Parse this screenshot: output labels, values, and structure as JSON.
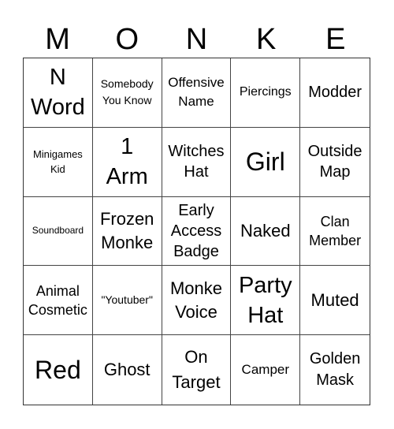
{
  "title_letters": [
    "M",
    "O",
    "N",
    "K",
    "E"
  ],
  "cells": [
    {
      "text": "N Word"
    },
    {
      "text": "Somebody You Know"
    },
    {
      "text": "Offensive Name"
    },
    {
      "text": "Piercings"
    },
    {
      "text": "Modder"
    },
    {
      "text": "Minigames Kid"
    },
    {
      "text": "1 Arm"
    },
    {
      "text": "Witches Hat"
    },
    {
      "text": "Girl"
    },
    {
      "text": "Outside Map"
    },
    {
      "text": "Soundboard"
    },
    {
      "text": "Frozen Monke"
    },
    {
      "text": "Early Access Badge"
    },
    {
      "text": "Naked"
    },
    {
      "text": "Clan Member"
    },
    {
      "text": "Animal Cosmetic"
    },
    {
      "text": "\"Youtuber\""
    },
    {
      "text": "Monke Voice"
    },
    {
      "text": "Party Hat"
    },
    {
      "text": "Muted"
    },
    {
      "text": "Red"
    },
    {
      "text": "Ghost"
    },
    {
      "text": "On Target"
    },
    {
      "text": "Camper"
    },
    {
      "text": "Golden Mask"
    }
  ]
}
